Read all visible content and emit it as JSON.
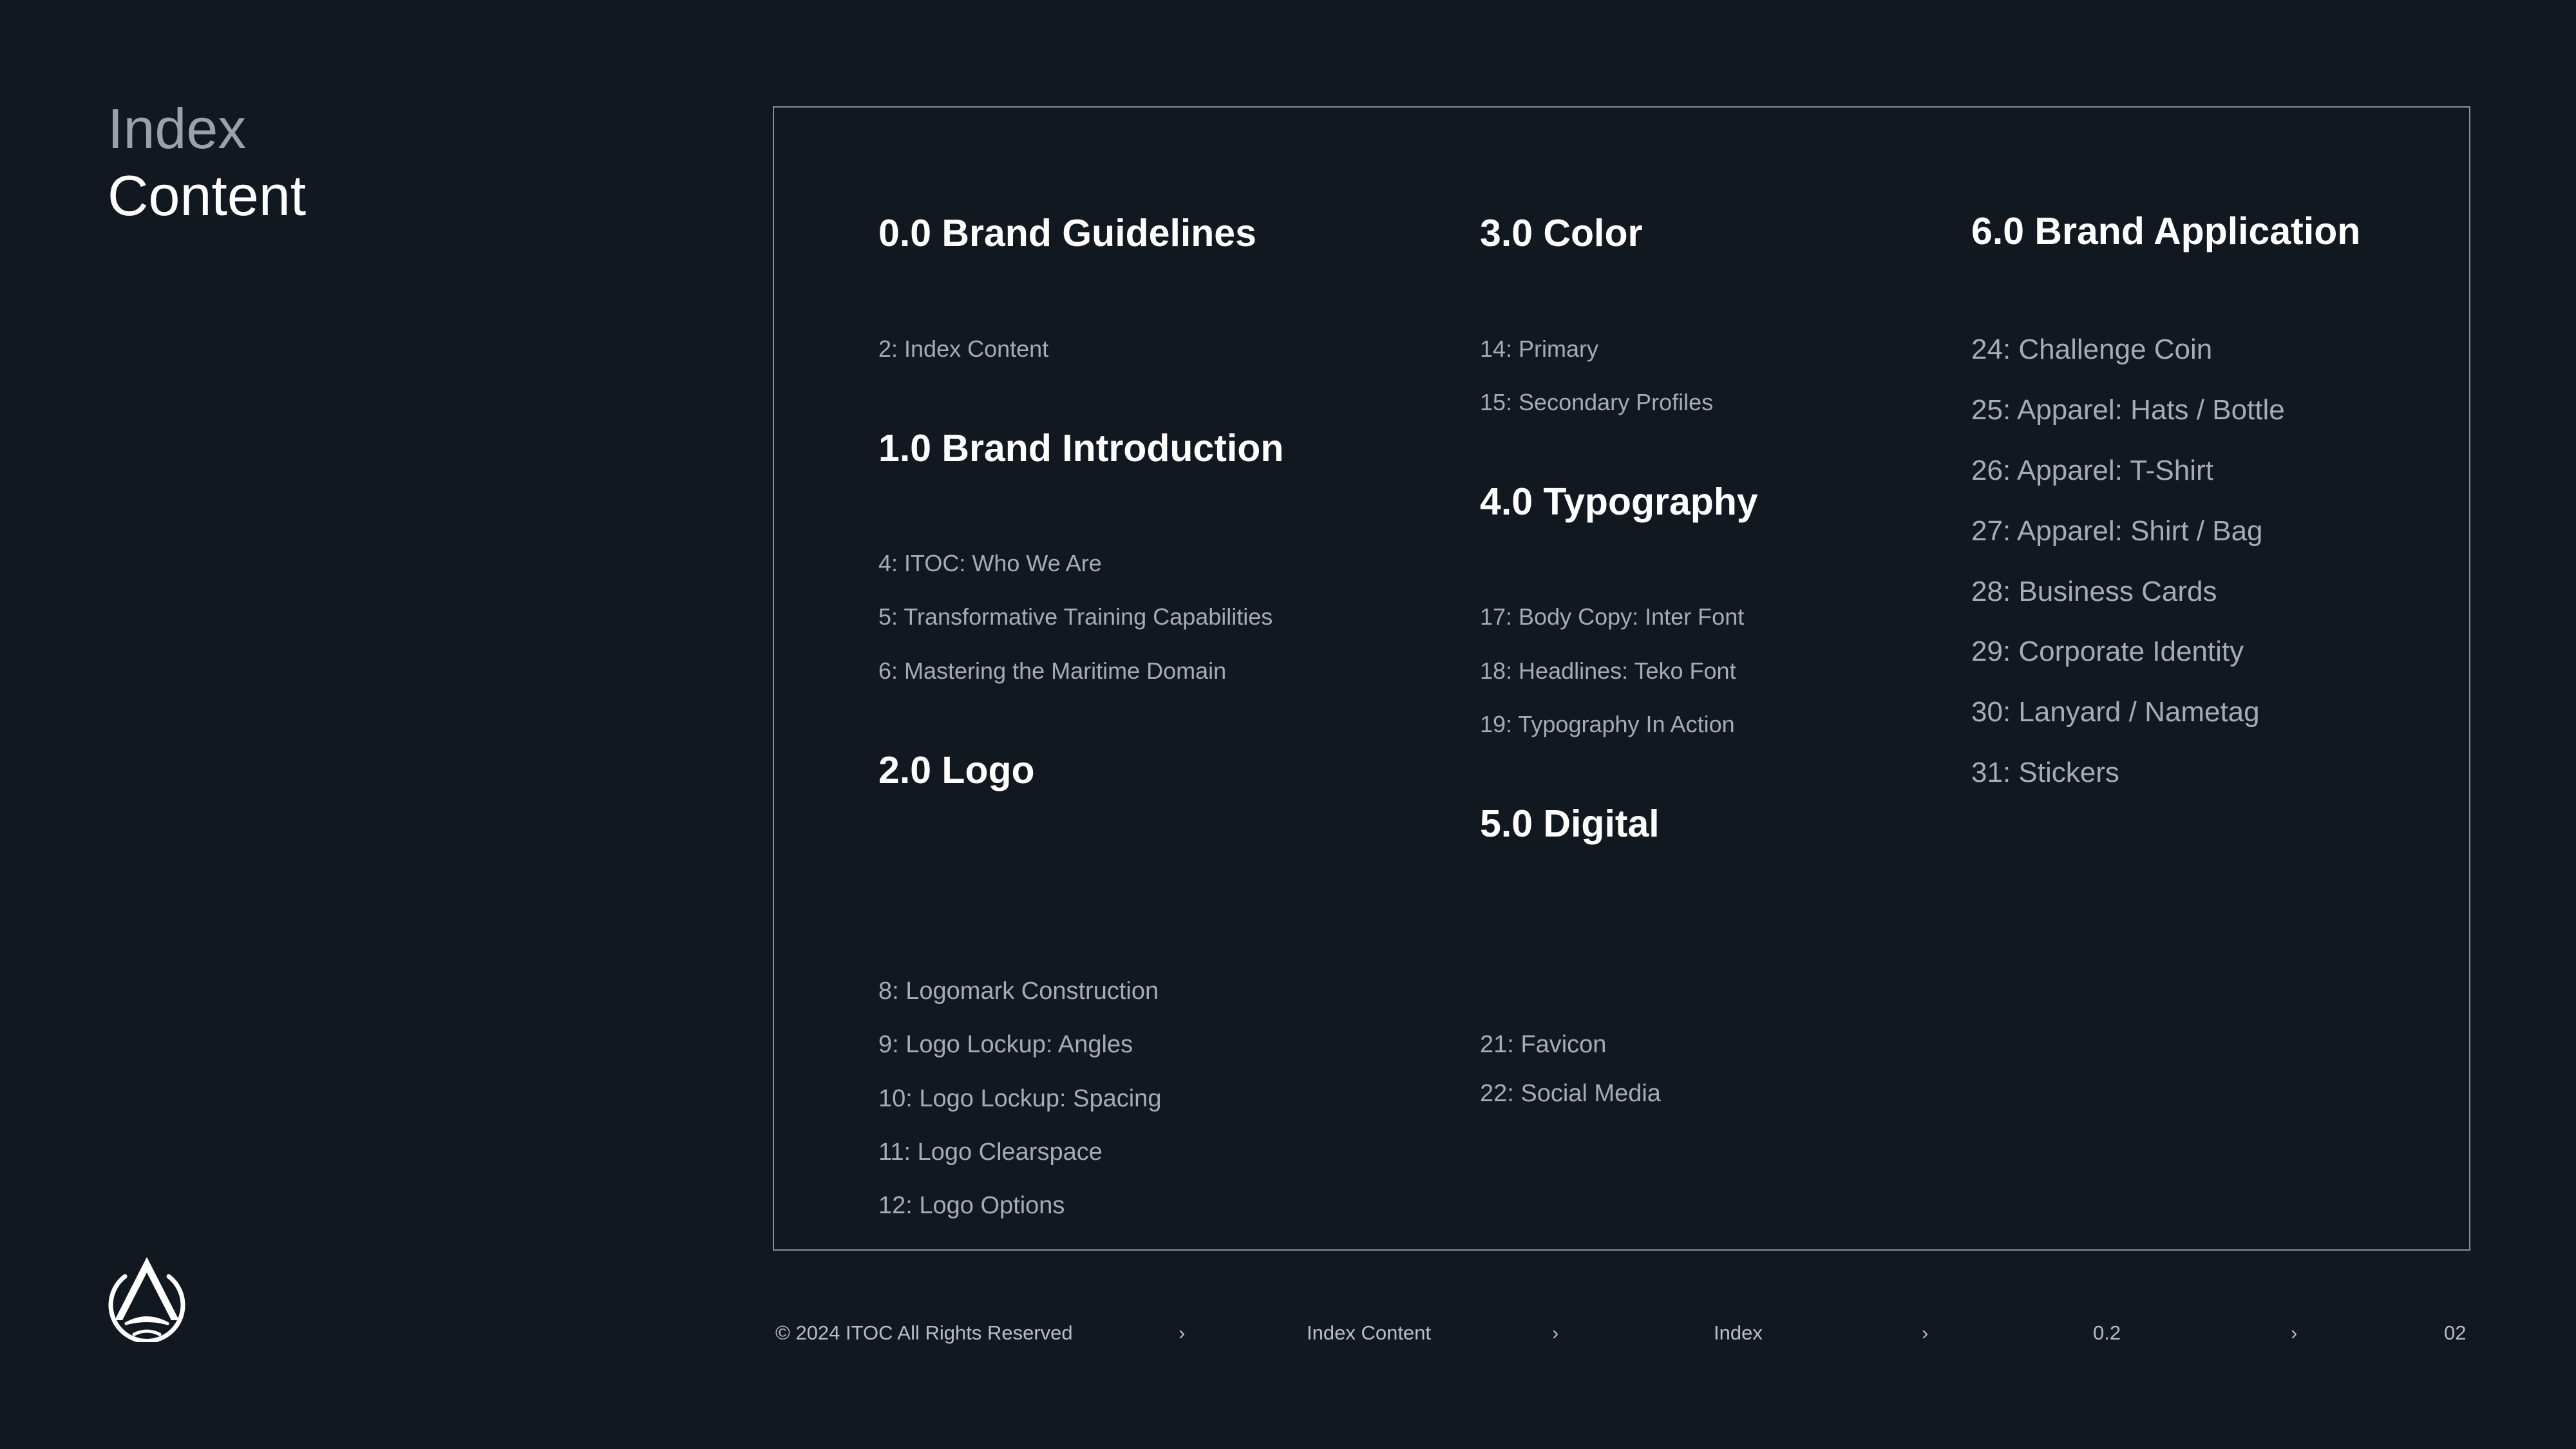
{
  "page_title": {
    "line1": "Index",
    "line2": "Content"
  },
  "sections": {
    "s0": {
      "title": "0.0 Brand Guidelines",
      "items": [
        "2: Index Content"
      ]
    },
    "s1": {
      "title": "1.0 Brand Introduction",
      "items": [
        "4: ITOC: Who We Are",
        "5: Transformative Training Capabilities",
        "6: Mastering the Maritime Domain"
      ]
    },
    "s2": {
      "title": "2.0 Logo",
      "items": [
        "8: Logomark Construction",
        "9: Logo Lockup: Angles",
        "10: Logo Lockup: Spacing",
        "11: Logo Clearspace",
        "12: Logo Options"
      ]
    },
    "s3": {
      "title": "3.0 Color",
      "items": [
        "14: Primary",
        "15: Secondary Profiles"
      ]
    },
    "s4": {
      "title": "4.0 Typography",
      "items": [
        "17: Body Copy: Inter Font",
        "18: Headlines: Teko Font",
        "19: Typography In Action"
      ]
    },
    "s5": {
      "title": "5.0 Digital",
      "items": [
        "21: Favicon",
        "22: Social Media"
      ]
    },
    "s6": {
      "title": "6.0 Brand Application",
      "items": [
        "24: Challenge Coin",
        "25: Apparel: Hats / Bottle",
        "26: Apparel: T-Shirt",
        "27: Apparel: Shirt / Bag",
        "28: Business Cards",
        "29: Corporate Identity",
        "30: Lanyard / Nametag",
        "31: Stickers"
      ]
    }
  },
  "footer": {
    "copyright": "© 2024 ITOC All Rights Reserved",
    "crumb_1": "Index Content",
    "crumb_2": "Index",
    "crumb_3": "0.2",
    "page_number": "02",
    "separator": "›"
  },
  "colors": {
    "background": "#111820",
    "heading": "#ffffff",
    "muted": "#a7acb4",
    "border": "#8a9099"
  },
  "icons": {
    "logo": "itoc-logomark-icon"
  }
}
